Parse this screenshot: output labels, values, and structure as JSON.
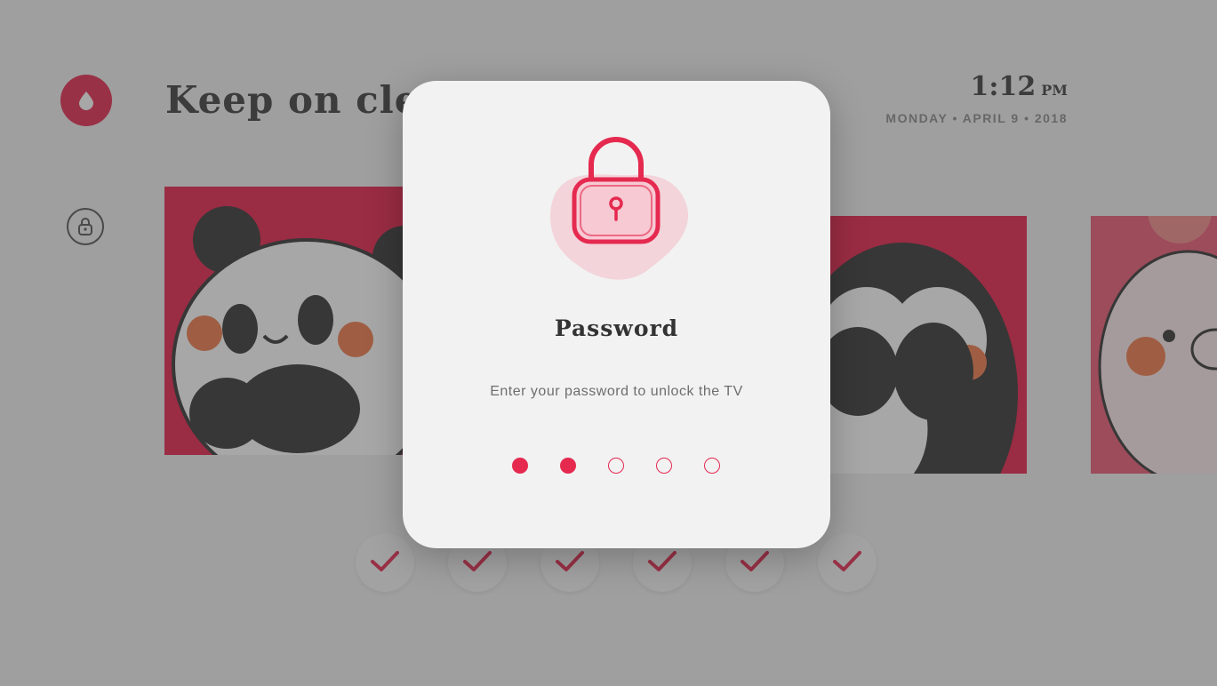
{
  "background": {
    "title": "Keep on cle",
    "clock": {
      "time": "1:12",
      "ampm": "PM"
    },
    "date": "MONDAY • APRIL 9 • 2018"
  },
  "modal": {
    "title": "Password",
    "subtitle": "Enter your password to unlock the TV",
    "pin": {
      "length": 5,
      "entered": 2
    }
  },
  "icons": {
    "brand": "drop-icon",
    "side": "lock-icon",
    "modal": "padlock-icon",
    "checks": "check-icon"
  },
  "colors": {
    "accent": "#e5294f",
    "modal_bg": "#f2f2f2",
    "text": "#333333",
    "muted": "#6e6e6e"
  }
}
